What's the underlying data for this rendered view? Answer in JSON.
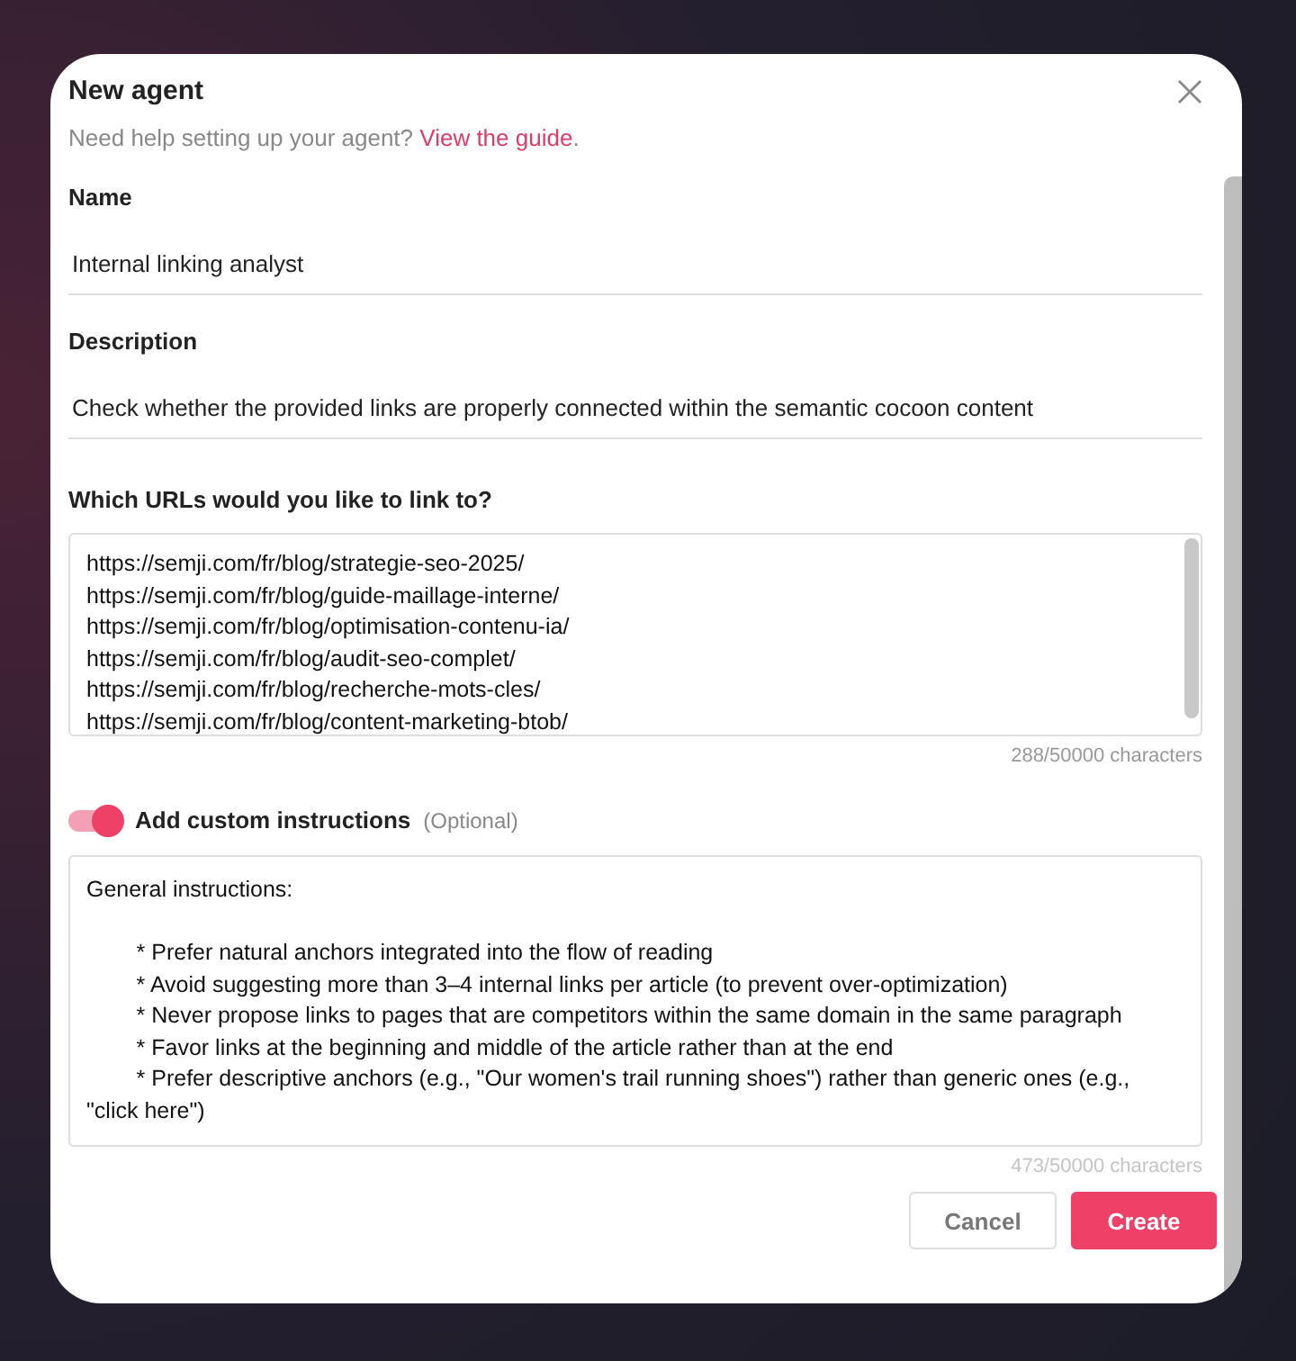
{
  "dialog": {
    "title": "New agent",
    "help_text": "Need help setting up your agent?",
    "help_link": "View the guide",
    "help_end": "."
  },
  "fields": [
    {
      "label": "Name",
      "value": "Internal linking analyst"
    },
    {
      "label": "Description",
      "value": "Check whether the provided links are properly connected within the semantic cocoon content"
    }
  ],
  "urls": {
    "label": "Which URLs would you like to link to?",
    "lines": [
      "https://semji.com/fr/blog/strategie-seo-2025/",
      "https://semji.com/fr/blog/guide-maillage-interne/",
      "https://semji.com/fr/blog/optimisation-contenu-ia/",
      "https://semji.com/fr/blog/audit-seo-complet/",
      "https://semji.com/fr/blog/recherche-mots-cles/",
      "https://semji.com/fr/blog/content-marketing-btob/"
    ],
    "counter": "288/50000 characters"
  },
  "custom_instructions": {
    "on": true,
    "label": "Add custom instructions",
    "optional": "(Optional)",
    "heading": "General instructions:",
    "bullets": [
      "* Prefer natural anchors integrated into the flow of reading",
      "* Avoid suggesting more than 3–4 internal links per article (to prevent over-optimization)",
      "* Never propose links to pages that are competitors within the same domain in the same paragraph",
      "* Favor links at the beginning and middle of the article rather than at the end",
      "* Prefer descriptive anchors (e.g., \"Our women's trail running shoes\") rather than generic ones (e.g., \"click here\")"
    ],
    "counter": "473/50000 characters"
  },
  "buttons": [
    {
      "label": "Cancel",
      "kind": "secondary"
    },
    {
      "label": "Create",
      "kind": "primary"
    }
  ]
}
